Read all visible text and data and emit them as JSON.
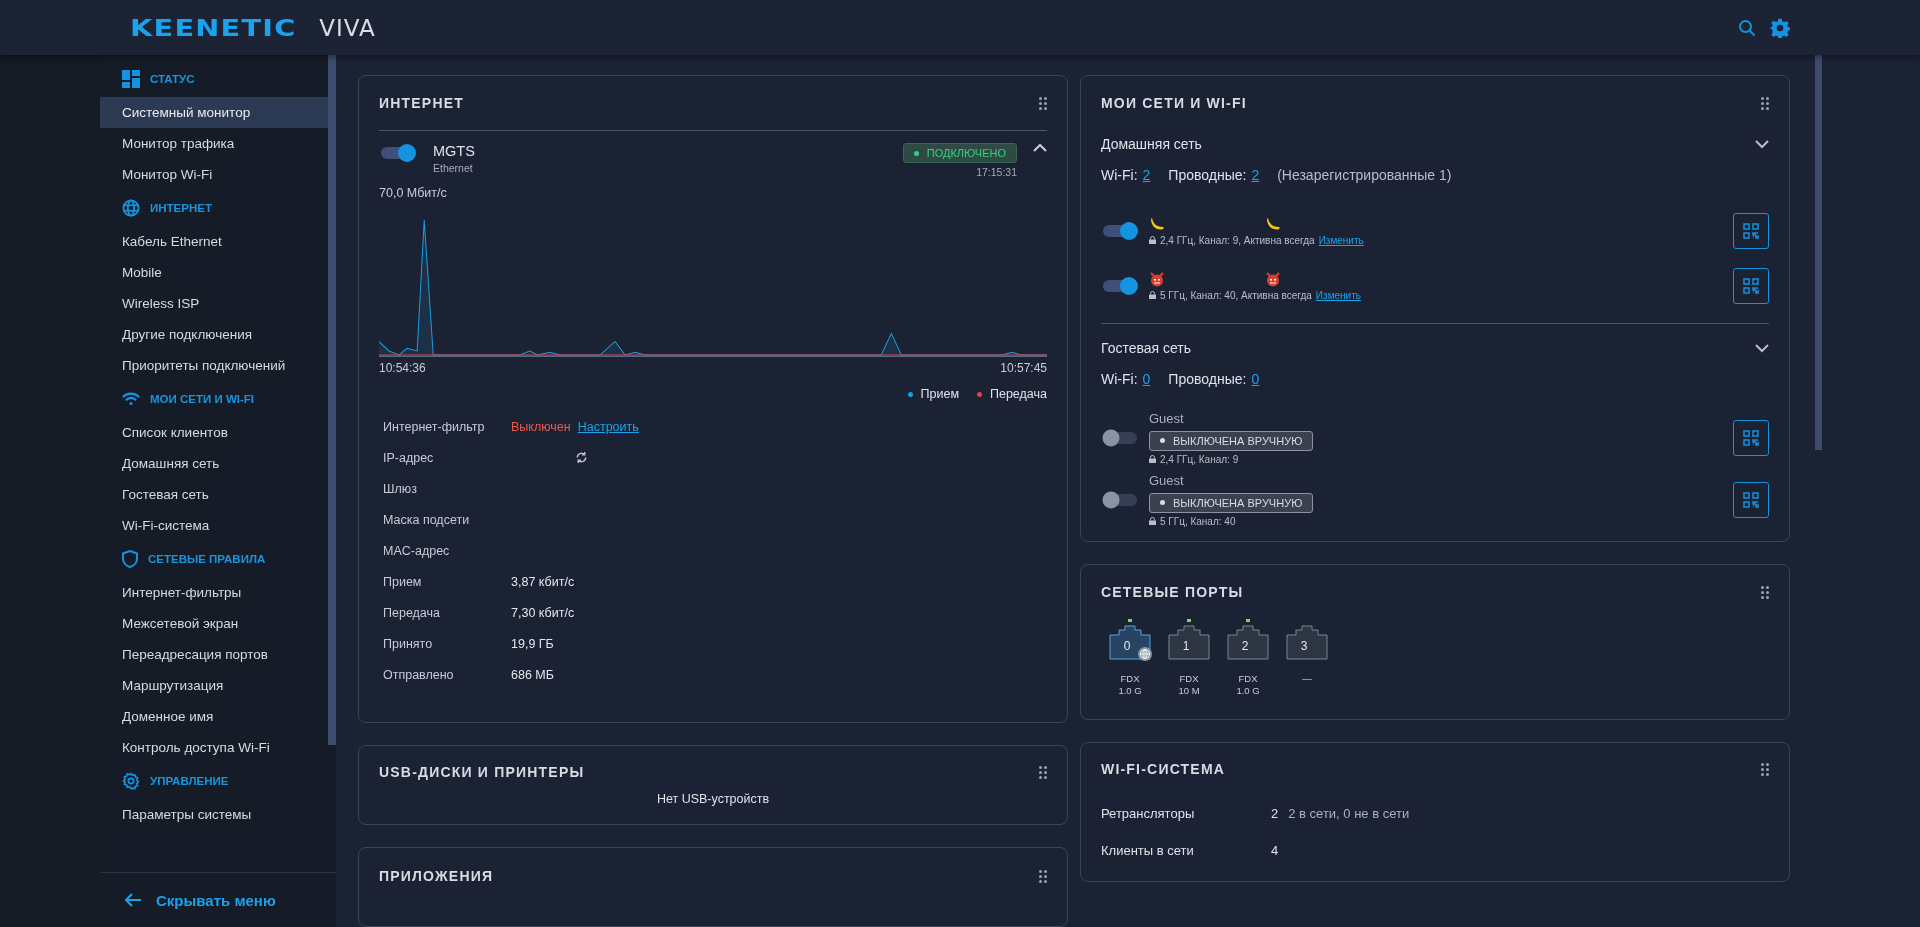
{
  "header": {
    "brand": "KEENETIC",
    "model": "VIVA"
  },
  "sidebar": {
    "sections": [
      {
        "title": "СТАТУС",
        "items": [
          {
            "label": "Системный монитор",
            "selected": true
          },
          {
            "label": "Монитор трафика",
            "selected": false
          },
          {
            "label": "Монитор Wi-Fi",
            "selected": false
          }
        ]
      },
      {
        "title": "ИНТЕРНЕТ",
        "items": [
          {
            "label": "Кабель Ethernet",
            "selected": false
          },
          {
            "label": "Mobile",
            "selected": false
          },
          {
            "label": "Wireless ISP",
            "selected": false
          },
          {
            "label": "Другие подключения",
            "selected": false
          },
          {
            "label": "Приоритеты подключений",
            "selected": false
          }
        ]
      },
      {
        "title": "МОИ СЕТИ И WI-FI",
        "items": [
          {
            "label": "Список клиентов",
            "selected": false
          },
          {
            "label": "Домашняя сеть",
            "selected": false
          },
          {
            "label": "Гостевая сеть",
            "selected": false
          },
          {
            "label": "Wi-Fi-система",
            "selected": false
          }
        ]
      },
      {
        "title": "СЕТЕВЫЕ ПРАВИЛА",
        "items": [
          {
            "label": "Интернет-фильтры",
            "selected": false
          },
          {
            "label": "Межсетевой экран",
            "selected": false
          },
          {
            "label": "Переадресация портов",
            "selected": false
          },
          {
            "label": "Маршрутизация",
            "selected": false
          },
          {
            "label": "Доменное имя",
            "selected": false
          },
          {
            "label": "Контроль доступа Wi-Fi",
            "selected": false
          }
        ]
      },
      {
        "title": "УПРАВЛЕНИЕ",
        "items": [
          {
            "label": "Параметры системы",
            "selected": false
          }
        ]
      }
    ],
    "footer": "Скрывать меню"
  },
  "internet": {
    "title": "ИНТЕРНЕТ",
    "connection": {
      "on": true,
      "name": "MGTS",
      "type": "Ethernet",
      "status": "ПОДКЛЮЧЕНО",
      "time": "17:15:31",
      "expanded": true
    },
    "chart": {
      "max_label": "70,0 Мбит/с",
      "start": "10:54:36",
      "end": "10:57:45",
      "legend": [
        {
          "label": "Прием",
          "color": "#1e9be0"
        },
        {
          "label": "Передача",
          "color": "#e0443c"
        }
      ]
    },
    "rows": [
      {
        "kind": "filter",
        "label": "Интернет-фильтр",
        "value": "Выключен",
        "link": "Настроить"
      },
      {
        "kind": "loading",
        "label": "IP-адрес"
      },
      {
        "kind": "plain",
        "label": "Шлюз"
      },
      {
        "kind": "plain",
        "label": "Маска подсети"
      },
      {
        "kind": "plain",
        "label": "MAC-адрес"
      },
      {
        "kind": "plain",
        "label": "Прием",
        "value": "3,87 кбит/с"
      },
      {
        "kind": "plain",
        "label": "Передача",
        "value": "7,30 кбит/с"
      },
      {
        "kind": "plain",
        "label": "Принято",
        "value": "19,9 ГБ"
      },
      {
        "kind": "plain",
        "label": "Отправлено",
        "value": "686 МБ"
      }
    ]
  },
  "usb": {
    "title": "USB-ДИСКИ И ПРИНТЕРЫ",
    "message": "Нет USB-устройств"
  },
  "apps": {
    "title": "ПРИЛОЖЕНИЯ"
  },
  "networks": {
    "title": "МОИ СЕТИ И WI-FI",
    "groups": [
      {
        "title": "Домашняя сеть",
        "expanded": false,
        "wifi_label": "Wi-Fi:",
        "wifi_count": "2",
        "wired_label": "Проводные:",
        "wired_count": "2",
        "note": "(Незарегистрированные 1)",
        "items": [
          {
            "kind": "named",
            "on": true,
            "details": "2,4 ГГц,  Канал: 9, Активна всегда",
            "link": "Изменить"
          },
          {
            "kind": "named",
            "on": true,
            "details": "5 ГГц,  Канал: 40, Активна всегда",
            "link": "Изменить"
          }
        ]
      },
      {
        "title": "Гостевая сеть",
        "expanded": false,
        "wifi_label": "Wi-Fi:",
        "wifi_count": "0",
        "wired_label": "Проводные:",
        "wired_count": "0",
        "items": [
          {
            "kind": "guest",
            "on": false,
            "name": "Guest",
            "status": "ВЫКЛЮЧЕНА ВРУЧНУЮ",
            "details": "2,4 ГГц,  Канал: 9"
          },
          {
            "kind": "guest",
            "on": false,
            "name": "Guest",
            "status": "ВЫКЛЮЧЕНА ВРУЧНУЮ",
            "details": "5 ГГц,  Канал: 40"
          }
        ]
      }
    ]
  },
  "ports": {
    "title": "СЕТЕВЫЕ ПОРТЫ",
    "items": [
      {
        "number": "0",
        "link": true,
        "wan": true,
        "duplex": "FDX",
        "speed": "1.0 G"
      },
      {
        "number": "1",
        "link": true,
        "wan": false,
        "duplex": "FDX",
        "speed": "10 M"
      },
      {
        "number": "2",
        "link": true,
        "wan": false,
        "duplex": "FDX",
        "speed": "1.0 G"
      },
      {
        "number": "3",
        "link": false,
        "wan": false,
        "speed": "—"
      }
    ]
  },
  "wifi_system": {
    "title": "WI-FI-СИСТЕМА",
    "rows": [
      {
        "label": "Ретрансляторы",
        "value": "2",
        "note": "2 в сети, 0 не в сети"
      },
      {
        "label": "Клиенты в сети",
        "value": "4"
      }
    ]
  }
}
